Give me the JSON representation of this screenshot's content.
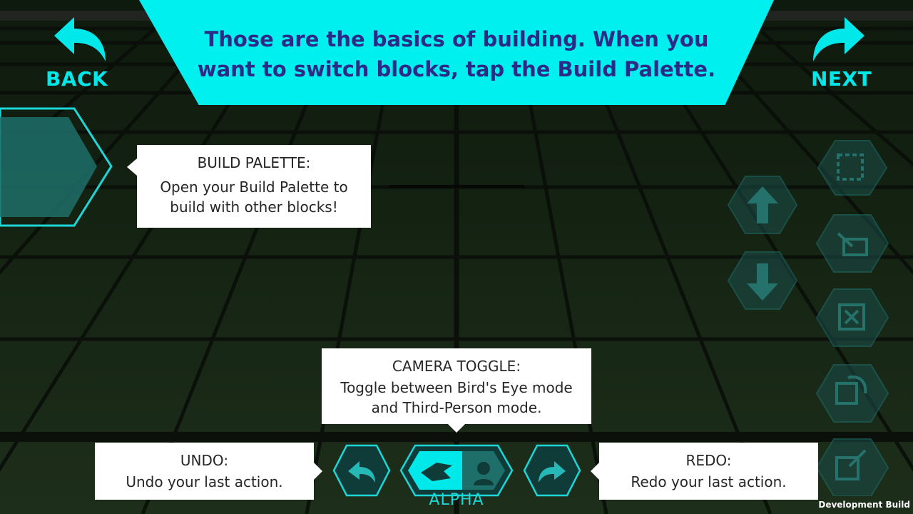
{
  "banner": {
    "line1": "Those are the basics of building. When you",
    "line2": "want to switch blocks, tap the Build Palette."
  },
  "nav": {
    "back_label": "BACK",
    "next_label": "NEXT"
  },
  "callouts": {
    "build_palette": {
      "title": "BUILD PALETTE:",
      "line1": "Open your Build Palette to",
      "line2": "build with other blocks!"
    },
    "camera_toggle": {
      "title": "CAMERA TOGGLE:",
      "line1": "Toggle between Bird's Eye mode",
      "line2": "and Third-Person mode."
    },
    "undo": {
      "title": "UNDO:",
      "line1": "Undo your last action."
    },
    "redo": {
      "title": "REDO:",
      "line1": "Redo your last action."
    }
  },
  "toolbar": {
    "mode_label": "ALPHA"
  },
  "footer": {
    "dev_build": "Development Build"
  },
  "side_buttons": [
    "select-icon",
    "raise-icon",
    "lower-icon",
    "hammer-icon",
    "delete-icon",
    "rotate-icon",
    "edit-icon"
  ],
  "colors": {
    "accent": "#00f0f0",
    "banner_text": "#2b2a86",
    "ground": "#142012",
    "grid_line": "#0a0f09"
  }
}
